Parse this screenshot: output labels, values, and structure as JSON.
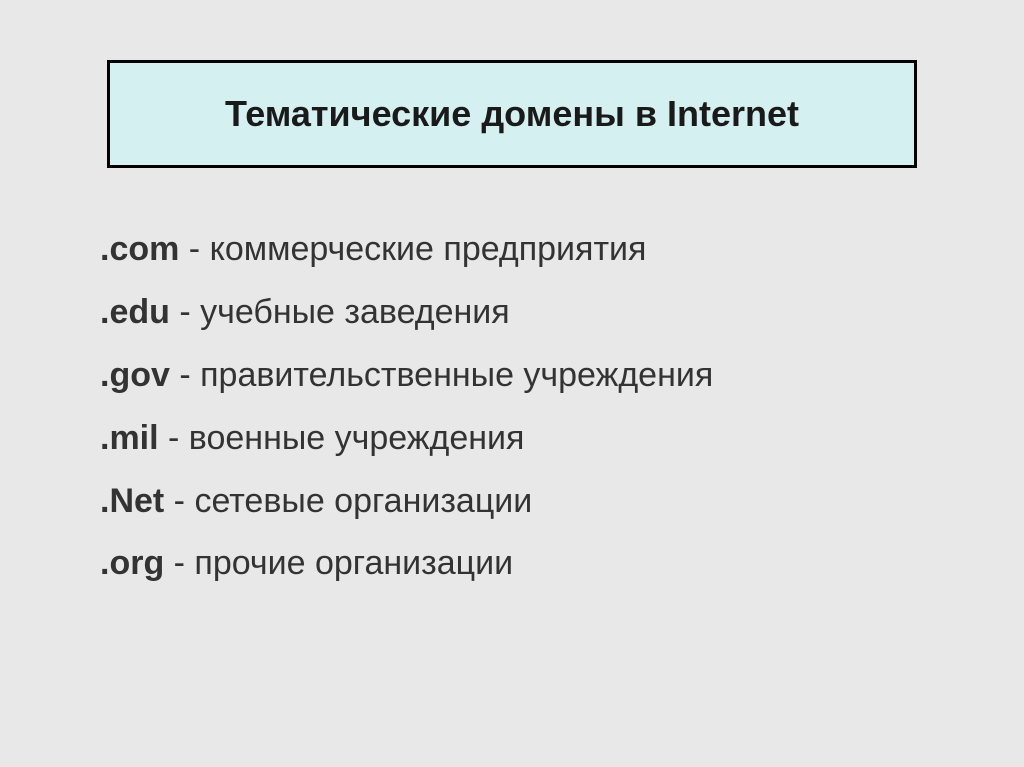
{
  "title": "Тематические домены в Internet",
  "domains": [
    {
      "prefix": ".com",
      "description": " - коммерческие предприятия"
    },
    {
      "prefix": ".edu",
      "description": " - учебные заведения"
    },
    {
      "prefix": ".gov",
      "description": " - правительственные учреждения"
    },
    {
      "prefix": ".mil",
      "description": " - военные учреждения"
    },
    {
      "prefix": ".Net",
      "description": " - сетевые организации"
    },
    {
      "prefix": ".org",
      "description": " - прочие организации"
    }
  ]
}
